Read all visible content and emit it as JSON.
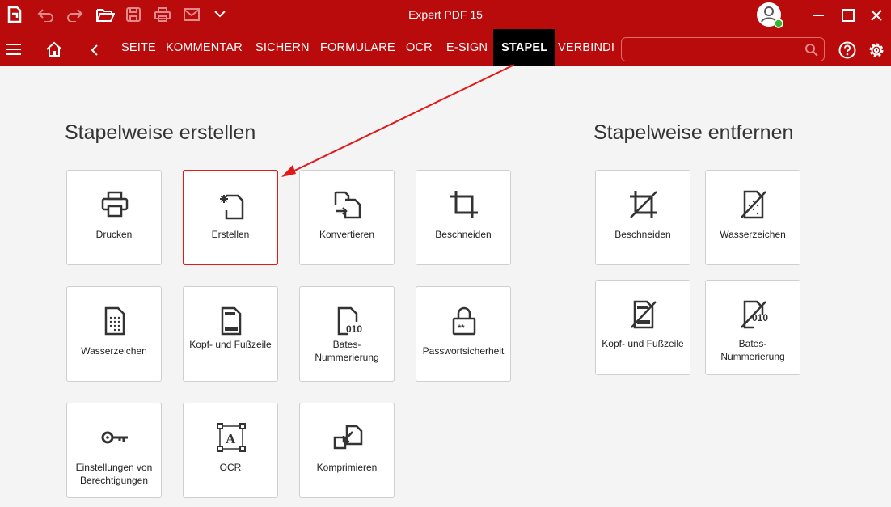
{
  "window": {
    "title": "Expert PDF 15"
  },
  "menu_tabs": [
    {
      "label": "SEITE"
    },
    {
      "label": "KOMMENTAR"
    },
    {
      "label": "SICHERN"
    },
    {
      "label": "FORMULARE"
    },
    {
      "label": "OCR"
    },
    {
      "label": "E-SIGN"
    },
    {
      "label": "STAPEL",
      "active": true
    },
    {
      "label": "VERBINDI"
    }
  ],
  "search": {
    "placeholder": ""
  },
  "sections": {
    "create": {
      "title": "Stapelweise erstellen",
      "tiles": [
        {
          "label": "Drucken",
          "icon": "printer-icon"
        },
        {
          "label": "Erstellen",
          "icon": "create-document-icon",
          "highlighted": true
        },
        {
          "label": "Konvertieren",
          "icon": "convert-icon"
        },
        {
          "label": "Beschneiden",
          "icon": "crop-icon"
        },
        {
          "label": "Wasserzeichen",
          "icon": "watermark-icon"
        },
        {
          "label": "Kopf- und Fußzeile",
          "icon": "header-footer-icon"
        },
        {
          "label": "Bates-Nummerierung",
          "icon": "bates-numbering-icon"
        },
        {
          "label": "Passwortsicherheit",
          "icon": "lock-icon"
        },
        {
          "label": "Einstellungen von Berechtigungen",
          "icon": "key-icon"
        },
        {
          "label": "OCR",
          "icon": "ocr-icon"
        },
        {
          "label": "Komprimieren",
          "icon": "compress-icon"
        }
      ]
    },
    "remove": {
      "title": "Stapelweise entfernen",
      "tiles": [
        {
          "label": "Beschneiden",
          "icon": "crop-remove-icon"
        },
        {
          "label": "Wasserzeichen",
          "icon": "watermark-remove-icon"
        },
        {
          "label": "Kopf- und Fußzeile",
          "icon": "header-footer-remove-icon"
        },
        {
          "label": "Bates-Nummerierung",
          "icon": "bates-remove-icon"
        }
      ]
    }
  },
  "colors": {
    "accent": "#b90b0b",
    "active_tab": "#000000",
    "highlight": "#e11919"
  }
}
